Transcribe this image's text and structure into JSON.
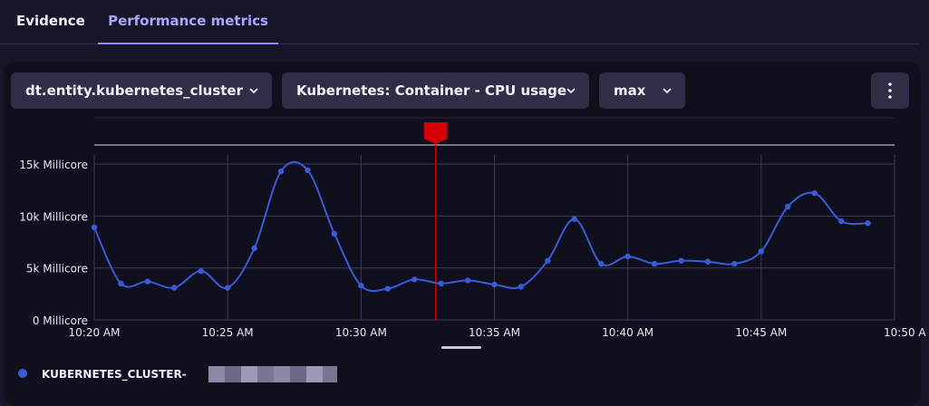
{
  "tabs": [
    {
      "label": "Evidence",
      "active": false
    },
    {
      "label": "Performance metrics",
      "active": true
    }
  ],
  "toolbar": {
    "entity_dropdown": "dt.entity.kubernetes_cluster",
    "metric_dropdown": "Kubernetes: Container - CPU usage",
    "aggregation_dropdown": "max",
    "menu_icon": "more-vertical-icon"
  },
  "colors": {
    "series": "#3a5bd9",
    "event_marker": "#d40000",
    "active_tab": "#a9a6ff"
  },
  "legend": {
    "label": "KUBERNETES_CLUSTER-",
    "redacted": true
  },
  "chart_data": {
    "type": "line",
    "ylabel": "",
    "xlabel": "",
    "y_unit": "Millicore",
    "yticks": [
      "0 Millicore",
      "5k Millicore",
      "10k Millicore",
      "15k Millicore"
    ],
    "ylim": [
      0,
      15000
    ],
    "xticks": [
      "10:20 AM",
      "10:25 AM",
      "10:30 AM",
      "10:35 AM",
      "10:40 AM",
      "10:45 AM",
      "10:50 A"
    ],
    "xlim_minutes": [
      0,
      30
    ],
    "event_marker_minute": 12.8,
    "grid": true,
    "series": [
      {
        "name": "KUBERNETES_CLUSTER-",
        "x_minutes": [
          0,
          1,
          2,
          3,
          4,
          5,
          6,
          7,
          8,
          9,
          10,
          11,
          12,
          13,
          14,
          15,
          16,
          17,
          18,
          19,
          20,
          21,
          22,
          23,
          24,
          25,
          26,
          27,
          28,
          29
        ],
        "values": [
          8900,
          3500,
          3700,
          3100,
          4700,
          3100,
          6900,
          14300,
          14400,
          8300,
          3300,
          3000,
          3900,
          3500,
          3800,
          3400,
          3200,
          5700,
          9700,
          5400,
          6100,
          5400,
          5700,
          5600,
          5400,
          6600,
          10900,
          12200,
          9500,
          9300
        ]
      }
    ]
  }
}
